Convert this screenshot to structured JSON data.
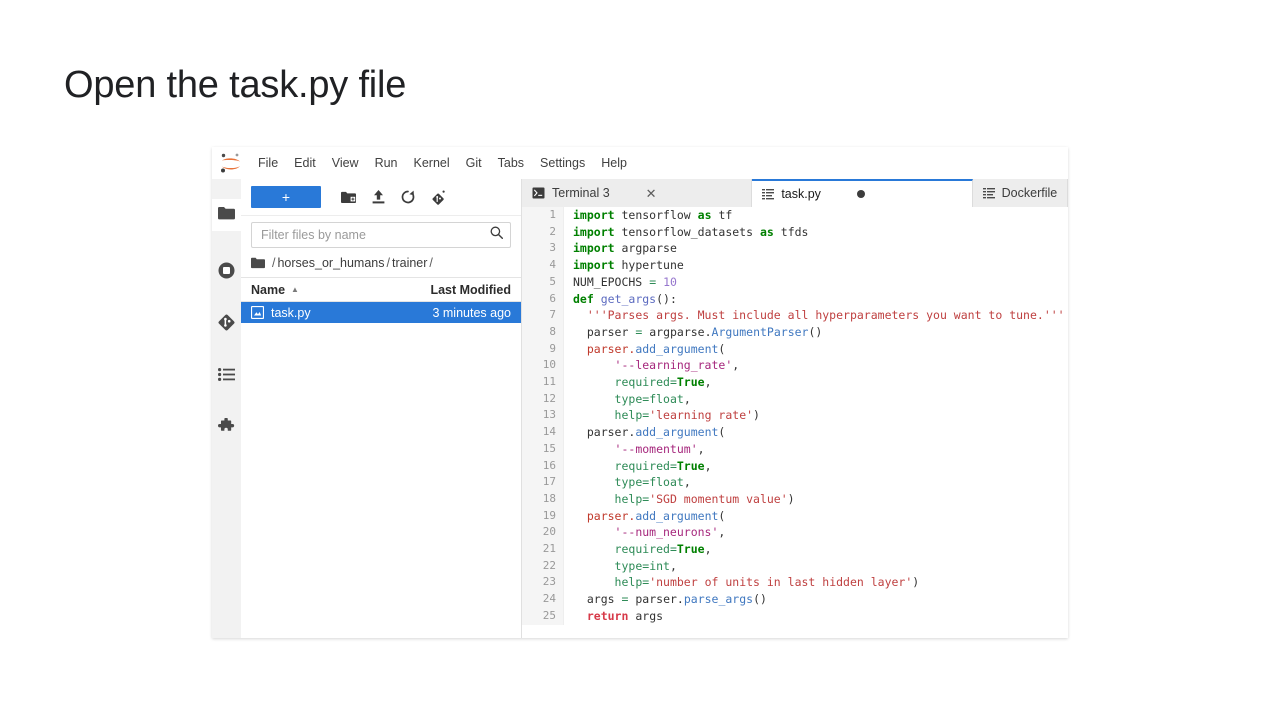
{
  "slide": {
    "title": "Open the task.py file"
  },
  "app": {
    "name": "JupyterLab",
    "logo_icon": "jupyter-logo-icon"
  },
  "menu_bar": {
    "items": [
      {
        "label": "File"
      },
      {
        "label": "Edit"
      },
      {
        "label": "View"
      },
      {
        "label": "Run"
      },
      {
        "label": "Kernel"
      },
      {
        "label": "Git"
      },
      {
        "label": "Tabs"
      },
      {
        "label": "Settings"
      },
      {
        "label": "Help"
      }
    ]
  },
  "activity_bar": {
    "items": [
      {
        "name": "file-browser-icon",
        "label": "File Browser",
        "active": true
      },
      {
        "name": "running-sessions-icon",
        "label": "Running Terminals and Kernels",
        "active": false
      },
      {
        "name": "git-icon",
        "label": "Git",
        "active": false
      },
      {
        "name": "commands-icon",
        "label": "Commands",
        "active": false
      },
      {
        "name": "extensions-icon",
        "label": "Extension Manager",
        "active": false
      }
    ]
  },
  "file_browser": {
    "toolbar": {
      "new_launcher_label": "+",
      "icons": [
        {
          "name": "new-folder-icon",
          "label": "New Folder"
        },
        {
          "name": "upload-icon",
          "label": "Upload Files"
        },
        {
          "name": "refresh-icon",
          "label": "Refresh File List"
        },
        {
          "name": "git-clone-icon",
          "label": "Git Clone"
        }
      ]
    },
    "filter": {
      "placeholder": "Filter files by name",
      "value": "",
      "icon": "search-icon"
    },
    "breadcrumb": {
      "root_icon": "folder-icon",
      "segments": [
        "horses_or_humans",
        "trainer"
      ],
      "separator": "/"
    },
    "columns": {
      "name": "Name",
      "last_modified": "Last Modified",
      "sort_caret": "▲"
    },
    "rows": [
      {
        "icon": "python-file-icon",
        "name": "task.py",
        "last_modified": "3 minutes ago",
        "selected": true
      }
    ]
  },
  "dock": {
    "tabs": [
      {
        "icon": "terminal-icon",
        "label": "Terminal 3",
        "active": false,
        "close_icon": "close-icon",
        "close_glyph": "✕"
      },
      {
        "icon": "text-file-icon",
        "label": "task.py",
        "active": true,
        "dirty": true
      },
      {
        "icon": "text-file-icon",
        "label": "Dockerfile",
        "active": false
      }
    ]
  },
  "editor": {
    "file": "task.py",
    "language": "python",
    "line_numbers": [
      1,
      2,
      3,
      4,
      5,
      6,
      7,
      8,
      9,
      10,
      11,
      12,
      13,
      14,
      15,
      16,
      17,
      18,
      19,
      20,
      21,
      22,
      23,
      24,
      25
    ],
    "lines": [
      "import tensorflow as tf",
      "import tensorflow_datasets as tfds",
      "import argparse",
      "import hypertune",
      "NUM_EPOCHS = 10",
      "def get_args():",
      "  '''Parses args. Must include all hyperparameters you want to tune.'''",
      "  parser = argparse.ArgumentParser()",
      "  parser.add_argument(",
      "      '--learning_rate',",
      "      required=True,",
      "      type=float,",
      "      help='learning rate')",
      "  parser.add_argument(",
      "      '--momentum',",
      "      required=True,",
      "      type=float,",
      "      help='SGD momentum value')",
      "  parser.add_argument(",
      "      '--num_neurons',",
      "      required=True,",
      "      type=int,",
      "      help='number of units in last hidden layer')",
      "  args = parser.parse_args()",
      "  return args"
    ]
  },
  "colors": {
    "accent_blue": "#2979d8",
    "selection_blue": "#2979d8",
    "jupyter_orange": "#e8733b",
    "gutter_bg": "#f5f5f5",
    "panel_bg": "#f2f2f2",
    "keyword_green": "#008000",
    "string_red": "#bf4040",
    "number_purple": "#9575cd",
    "method_blue": "#4078c0",
    "return_red": "#d73a49"
  }
}
